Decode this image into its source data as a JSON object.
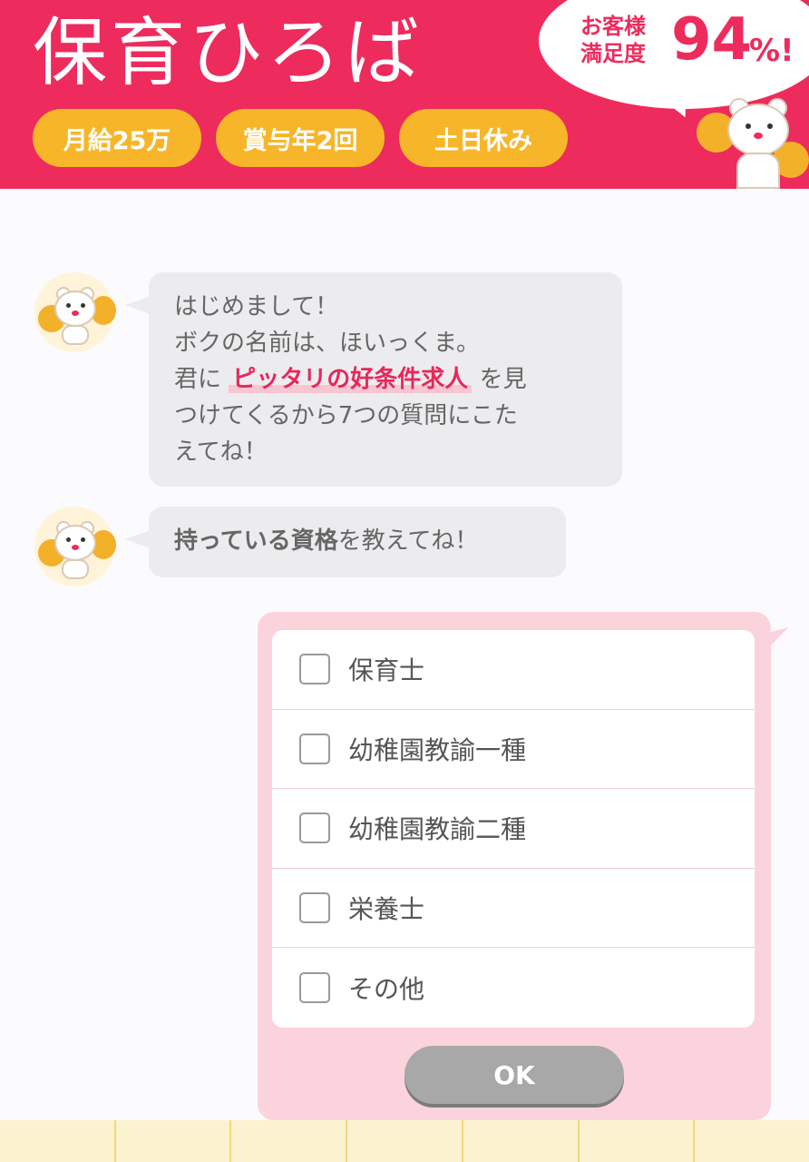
{
  "header": {
    "logo": "保育ひろば",
    "badges": [
      "月給25万",
      "賞与年2回",
      "土日休み"
    ],
    "satisfaction_label_line1": "お客様",
    "satisfaction_label_line2": "満足度",
    "satisfaction_value": "94",
    "satisfaction_suffix": "%!"
  },
  "chat": {
    "message1": {
      "line1": "はじめまして！",
      "line2": "ボクの名前は、ほいっくま。",
      "line3_prefix": "君に",
      "line3_highlight": "ピッタリの好条件求人",
      "line3_suffix": "を見",
      "line4": "つけてくるから7つの質問にこた",
      "line5": "えてね！"
    },
    "message2": {
      "strong": "持っている資格",
      "rest": "を教えてね！"
    }
  },
  "qualifications": {
    "options": [
      "保育士",
      "幼稚園教諭一種",
      "幼稚園教諭二種",
      "栄養士",
      "その他"
    ],
    "submit_label": "OK"
  },
  "colors": {
    "brand_pink": "#ee2b5d",
    "badge_yellow": "#f7b629",
    "panel_pink": "#fbd3dd"
  }
}
